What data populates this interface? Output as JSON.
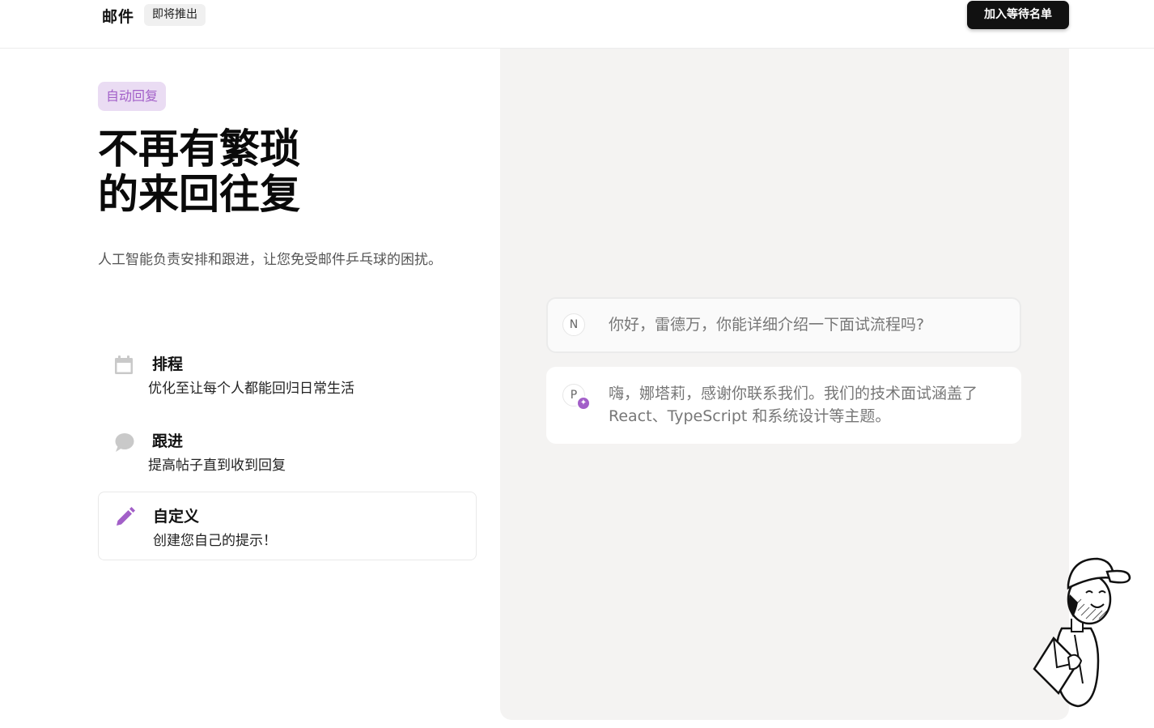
{
  "header": {
    "brand": "邮件",
    "badge": "即将推出",
    "cta_label": "加入等待名单"
  },
  "hero": {
    "tag": "自动回复",
    "headline_line1": "不再有繁琐",
    "headline_line2": "的来回往复",
    "subtitle": "人工智能负责安排和跟进，让您免受邮件乒乓球的困扰。"
  },
  "features": [
    {
      "icon": "calendar-icon",
      "title": "排程",
      "description": "优化至让每个人都能回归日常生活",
      "active": false
    },
    {
      "icon": "chat-bubble-icon",
      "title": "跟进",
      "description": "提高帖子直到收到回复",
      "active": false
    },
    {
      "icon": "pencil-icon",
      "title": "自定义",
      "description": "创建您自己的提示！",
      "active": true
    }
  ],
  "conversation": [
    {
      "avatar": "N",
      "text": "你好，雷德万，你能详细介绍一下面试流程吗?"
    },
    {
      "avatar": "P",
      "badge": "sparkle-icon",
      "text": "嗨，娜塔莉，感谢你联系我们。我们的技术面试涵盖了 React、TypeScript 和系统设计等主题。"
    }
  ],
  "colors": {
    "accent": "#a25fc8",
    "tag_bg": "#eadcf3",
    "panel_bg": "#f4f3f2",
    "cta_bg": "#111111"
  }
}
